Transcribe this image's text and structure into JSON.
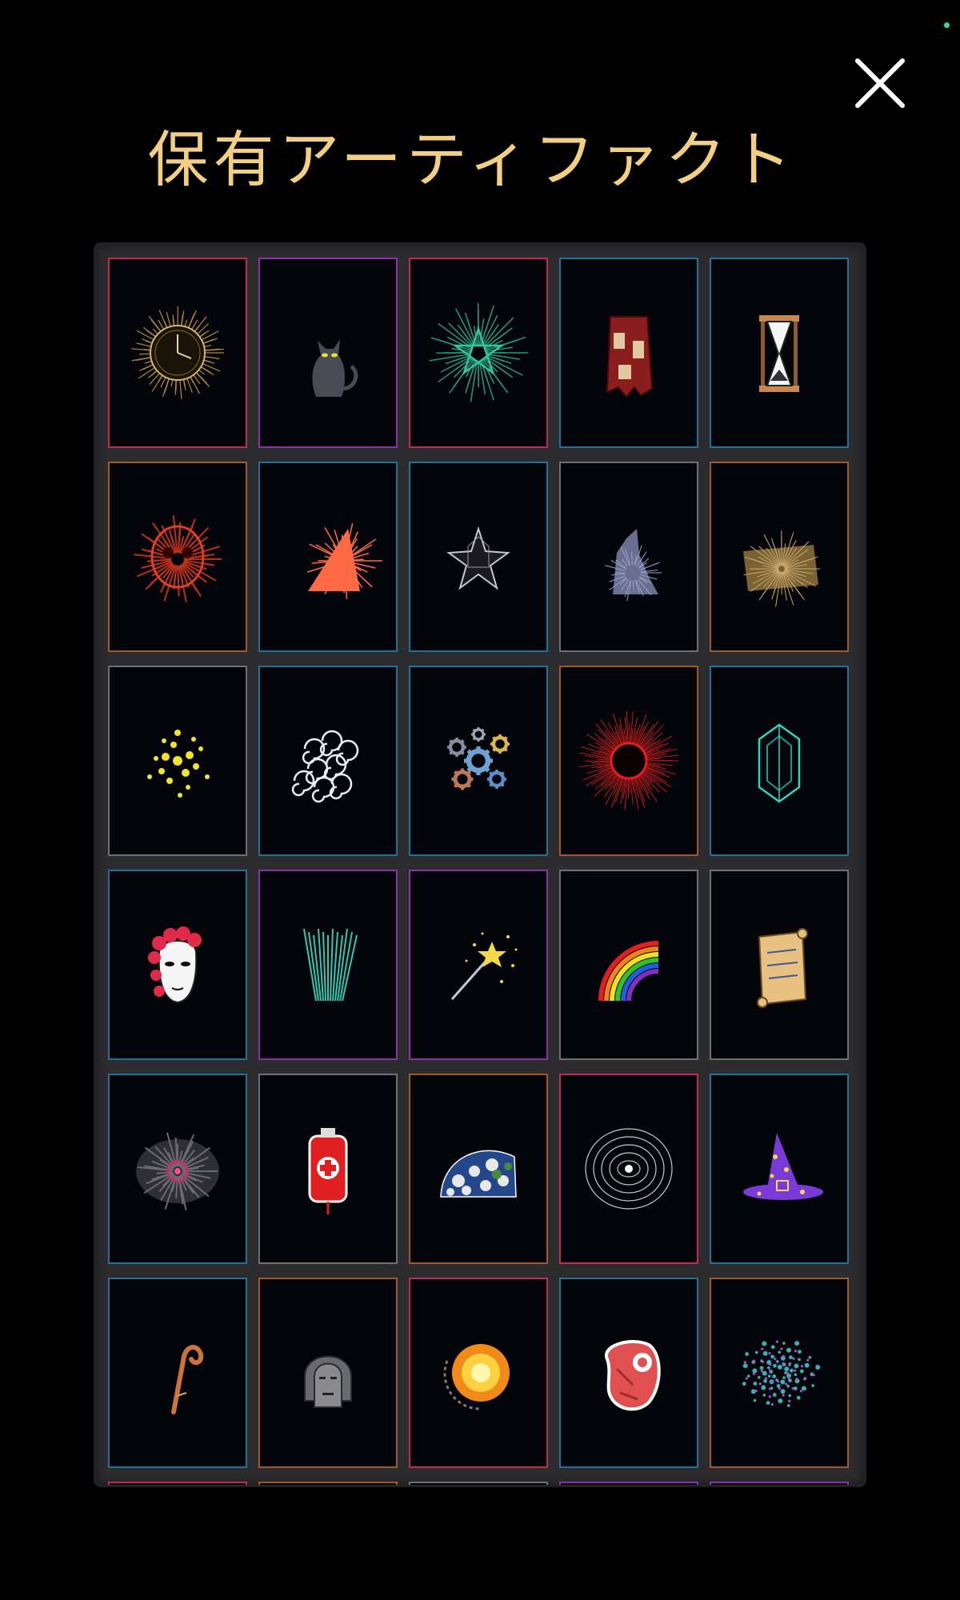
{
  "header": {
    "title": "保有アーティファクト"
  },
  "colors": {
    "title": "#f2cf83",
    "panel": "#2c2c2e",
    "rarity_red": "#c22a55",
    "rarity_purple": "#8a33a6",
    "rarity_blue": "#1f7399",
    "rarity_orange": "#a0592a",
    "rarity_gray": "#707070"
  },
  "artifacts": [
    {
      "icon": "clock-icon",
      "rarity": "red"
    },
    {
      "icon": "black-cat-icon",
      "rarity": "purple"
    },
    {
      "icon": "thorn-pentagram-icon",
      "rarity": "red"
    },
    {
      "icon": "tattered-robe-icon",
      "rarity": "blue"
    },
    {
      "icon": "hourglass-icon",
      "rarity": "blue"
    },
    {
      "icon": "red-skull-icon",
      "rarity": "orange"
    },
    {
      "icon": "orange-spike-icon",
      "rarity": "blue"
    },
    {
      "icon": "shuriken-star-icon",
      "rarity": "blue"
    },
    {
      "icon": "gray-claw-icon",
      "rarity": "gray"
    },
    {
      "icon": "straw-bundle-icon",
      "rarity": "orange"
    },
    {
      "icon": "yellow-sparks-icon",
      "rarity": "gray"
    },
    {
      "icon": "wind-swirls-icon",
      "rarity": "blue"
    },
    {
      "icon": "gears-icon",
      "rarity": "blue"
    },
    {
      "icon": "red-burst-icon",
      "rarity": "orange"
    },
    {
      "icon": "teal-crystal-icon",
      "rarity": "blue"
    },
    {
      "icon": "rose-mask-icon",
      "rarity": "blue"
    },
    {
      "icon": "teal-arrows-icon",
      "rarity": "purple"
    },
    {
      "icon": "magic-wand-icon",
      "rarity": "purple"
    },
    {
      "icon": "rainbow-icon",
      "rarity": "gray"
    },
    {
      "icon": "scroll-icon",
      "rarity": "gray"
    },
    {
      "icon": "dark-vortex-icon",
      "rarity": "blue"
    },
    {
      "icon": "blood-bag-icon",
      "rarity": "gray"
    },
    {
      "icon": "earth-globe-icon",
      "rarity": "orange"
    },
    {
      "icon": "white-ripple-icon",
      "rarity": "red"
    },
    {
      "icon": "witch-hat-icon",
      "rarity": "blue"
    },
    {
      "icon": "wooden-staff-icon",
      "rarity": "blue"
    },
    {
      "icon": "stone-idol-icon",
      "rarity": "orange"
    },
    {
      "icon": "sun-orb-icon",
      "rarity": "red"
    },
    {
      "icon": "raw-meat-icon",
      "rarity": "blue"
    },
    {
      "icon": "cosmic-cluster-icon",
      "rarity": "orange"
    },
    {
      "icon": "",
      "rarity": "red"
    },
    {
      "icon": "",
      "rarity": "orange"
    },
    {
      "icon": "",
      "rarity": "gray"
    },
    {
      "icon": "",
      "rarity": "purple"
    },
    {
      "icon": "",
      "rarity": "purple"
    }
  ]
}
